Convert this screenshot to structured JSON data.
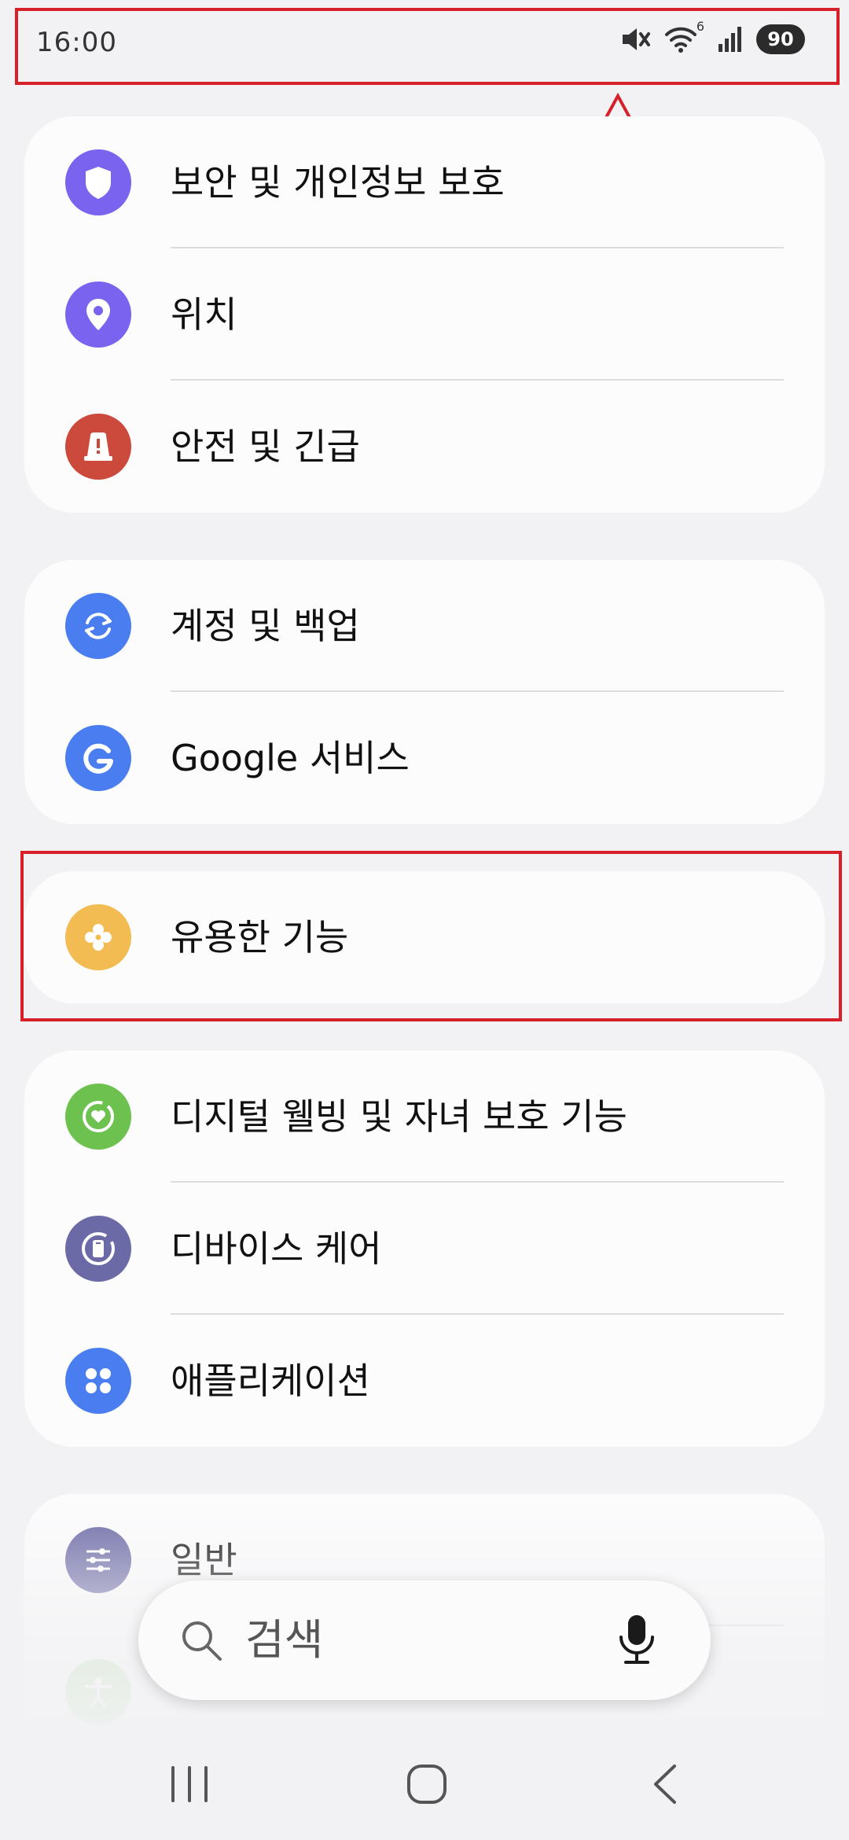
{
  "status_bar": {
    "time": "16:00",
    "battery": "90",
    "icons": [
      "mute-icon",
      "wifi-icon",
      "signal-icon",
      "battery-icon"
    ],
    "wifi_badge": "6"
  },
  "groups": [
    {
      "items": [
        {
          "label": "보안 및 개인정보 보호",
          "icon": "shield-icon",
          "color": "#7a63ef"
        },
        {
          "label": "위치",
          "icon": "location-pin-icon",
          "color": "#7a63ef"
        },
        {
          "label": "안전 및 긴급",
          "icon": "emergency-icon",
          "color": "#cc4a3c"
        }
      ]
    },
    {
      "items": [
        {
          "label": "계정 및 백업",
          "icon": "sync-icon",
          "color": "#4a7ef0"
        },
        {
          "label": "Google 서비스",
          "icon": "google-icon",
          "color": "#4a7ef0"
        }
      ]
    },
    {
      "items": [
        {
          "label": "유용한 기능",
          "icon": "puzzle-icon",
          "color": "#f2bc52"
        }
      ]
    },
    {
      "items": [
        {
          "label": "디지털 웰빙 및 자녀 보호 기능",
          "icon": "wellbeing-icon",
          "color": "#6dc14e"
        },
        {
          "label": "디바이스 케어",
          "icon": "device-care-icon",
          "color": "#6c6aa6"
        },
        {
          "label": "애플리케이션",
          "icon": "apps-icon",
          "color": "#4a7ef0"
        }
      ]
    },
    {
      "items": [
        {
          "label": "일반",
          "icon": "sliders-icon",
          "color": "#6c6aa6"
        },
        {
          "label": "",
          "icon": "accessibility-icon",
          "color": "#9fd48a"
        }
      ]
    }
  ],
  "search": {
    "placeholder": "검색",
    "icons": [
      "search-icon",
      "mic-icon"
    ]
  },
  "navigation": {
    "icons": [
      "recents-icon",
      "home-icon",
      "back-icon"
    ]
  },
  "annotation_color": "#d6202a"
}
